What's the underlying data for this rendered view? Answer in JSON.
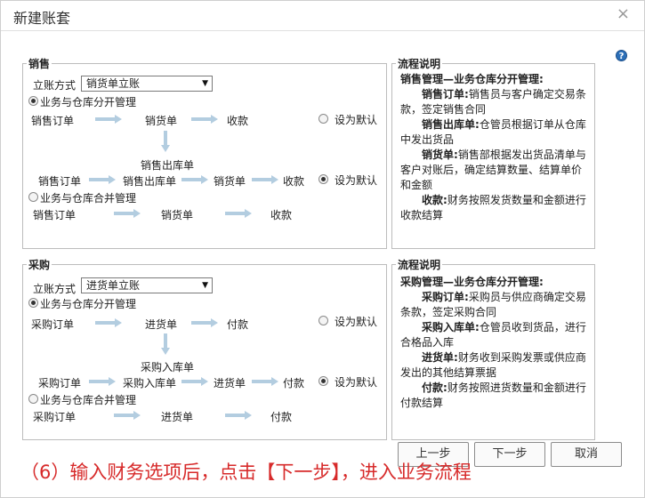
{
  "dialog": {
    "title": "新建账套",
    "close_glyph": "×",
    "help_glyph": "?"
  },
  "sales": {
    "legend": "销售",
    "method_label": "立账方式",
    "method_value": "销货单立账",
    "option_separate": "业务与仓库分开管理",
    "option_merged": "业务与仓库合并管理",
    "set_default": "设为默认",
    "flow1": [
      "销售订单",
      "销货单",
      "收款"
    ],
    "mid_node": "销售出库单",
    "flow2": [
      "销售订单",
      "销售出库单",
      "销货单",
      "收款"
    ],
    "flow3": [
      "销售订单",
      "销货单",
      "收款"
    ]
  },
  "sales_desc": {
    "legend": "流程说明",
    "heading": "销售管理—业务仓库分开管理:",
    "items": [
      {
        "k": "销售订单:",
        "v": "销售员与客户确定交易条款，签定销售合同"
      },
      {
        "k": "销售出库单:",
        "v": "仓管员根据订单从仓库中发出货品"
      },
      {
        "k": "销货单:",
        "v": "销售部根据发出货品清单与客户对账后，确定结算数量、结算单价和金额"
      },
      {
        "k": "收款:",
        "v": "财务按照发货数量和金额进行收款结算"
      }
    ]
  },
  "purchase": {
    "legend": "采购",
    "method_label": "立账方式",
    "method_value": "进货单立账",
    "option_separate": "业务与仓库分开管理",
    "option_merged": "业务与仓库合并管理",
    "set_default": "设为默认",
    "flow1": [
      "采购订单",
      "进货单",
      "付款"
    ],
    "mid_node": "采购入库单",
    "flow2": [
      "采购订单",
      "采购入库单",
      "进货单",
      "付款"
    ],
    "flow3": [
      "采购订单",
      "进货单",
      "付款"
    ]
  },
  "purchase_desc": {
    "legend": "流程说明",
    "heading": "采购管理—业务仓库分开管理:",
    "items": [
      {
        "k": "采购订单:",
        "v": "采购员与供应商确定交易条款，签定采购合同"
      },
      {
        "k": "采购入库单:",
        "v": "仓管员收到货品，进行合格品入库"
      },
      {
        "k": "进货单:",
        "v": "财务收到采购发票或供应商发出的其他结算票据"
      },
      {
        "k": "付款:",
        "v": "财务按照进货数量和金额进行付款结算"
      }
    ]
  },
  "buttons": {
    "prev": "上一步",
    "next": "下一步",
    "cancel": "取消"
  },
  "caption": "（6）输入财务选项后，点击【下一步】，进入业务流程"
}
